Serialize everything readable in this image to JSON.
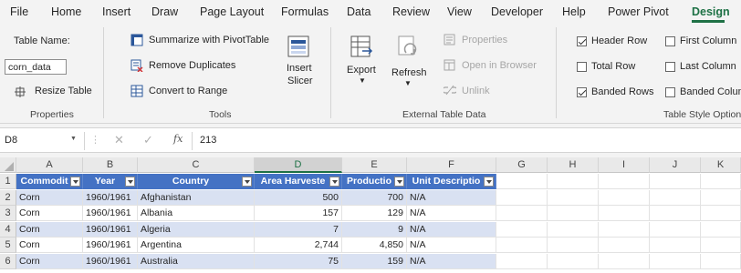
{
  "menu": {
    "tabs": [
      "File",
      "Home",
      "Insert",
      "Draw",
      "Page Layout",
      "Formulas",
      "Data",
      "Review",
      "View",
      "Developer",
      "Help",
      "Power Pivot",
      "Design"
    ],
    "active": "Design"
  },
  "ribbon": {
    "properties": {
      "table_name_label": "Table Name:",
      "table_name_value": "corn_data",
      "resize_label": "Resize Table",
      "group_label": "Properties"
    },
    "tools": {
      "summarize": "Summarize with PivotTable",
      "remove_dup": "Remove Duplicates",
      "convert": "Convert to Range",
      "insert_slicer_1": "Insert",
      "insert_slicer_2": "Slicer",
      "group_label": "Tools"
    },
    "external": {
      "export": "Export",
      "refresh": "Refresh",
      "properties": "Properties",
      "open_browser": "Open in Browser",
      "unlink": "Unlink",
      "group_label": "External Table Data"
    },
    "style_options": {
      "header_row": "Header Row",
      "total_row": "Total Row",
      "banded_rows": "Banded Rows",
      "first_column": "First Column",
      "last_column": "Last Column",
      "banded_columns": "Banded Colum",
      "header_row_checked": true,
      "total_row_checked": false,
      "banded_rows_checked": true,
      "first_column_checked": false,
      "last_column_checked": false,
      "banded_columns_checked": false,
      "group_label": "Table Style Option"
    }
  },
  "formula_bar": {
    "name_box": "D8",
    "fx": "fx",
    "value": "213"
  },
  "grid": {
    "columns": [
      "A",
      "B",
      "C",
      "D",
      "E",
      "F",
      "G",
      "H",
      "I",
      "J",
      "K"
    ],
    "row_numbers": [
      "1",
      "2",
      "3",
      "4",
      "5",
      "6"
    ],
    "headers": [
      "Commodit",
      "Year",
      "Country",
      "Area Harveste",
      "Productio",
      "Unit Descriptio"
    ],
    "rows": [
      [
        "Corn",
        "1960/1961",
        "Afghanistan",
        "500",
        "700",
        "N/A"
      ],
      [
        "Corn",
        "1960/1961",
        "Albania",
        "157",
        "129",
        "N/A"
      ],
      [
        "Corn",
        "1960/1961",
        "Algeria",
        "7",
        "9",
        "N/A"
      ],
      [
        "Corn",
        "1960/1961",
        "Argentina",
        "2,744",
        "4,850",
        "N/A"
      ],
      [
        "Corn",
        "1960/1961",
        "Australia",
        "75",
        "159",
        "N/A"
      ]
    ]
  },
  "colors": {
    "accent": "#1e7145",
    "table_header": "#4472c4",
    "table_band": "#d9e1f2"
  }
}
